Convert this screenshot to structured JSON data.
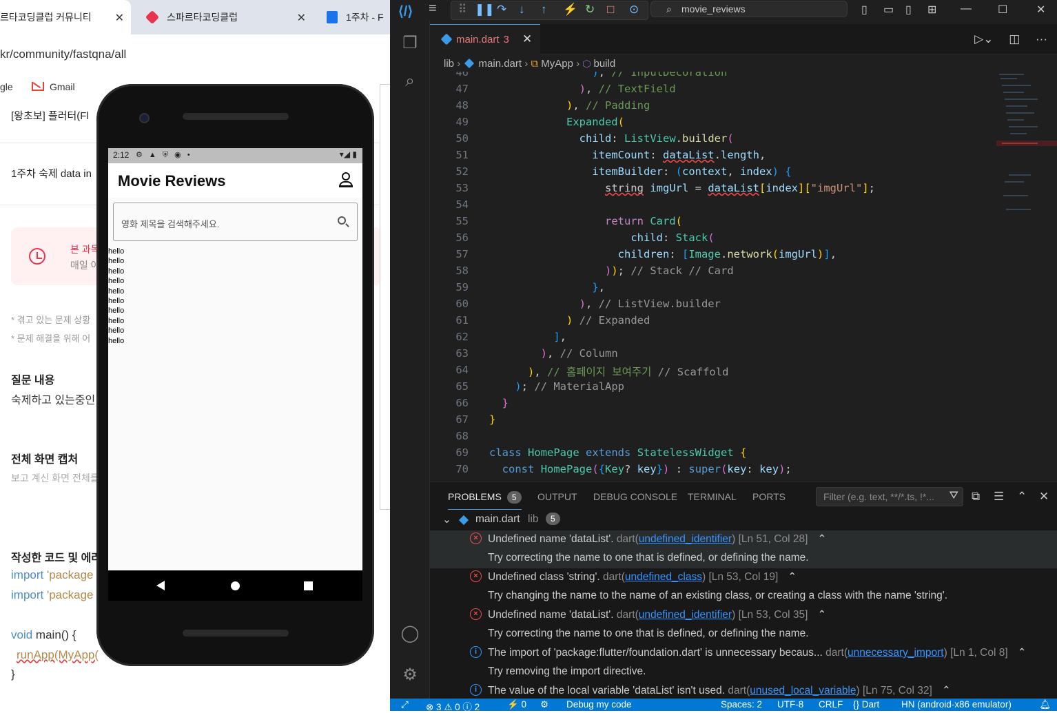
{
  "browser": {
    "tabs": [
      {
        "label": "르타코딩클럽 커뮤니티"
      },
      {
        "label": "스파르타코딩클럽"
      },
      {
        "label": "1주차 - F"
      }
    ],
    "address": "kr/community/fastqna/all",
    "bookmarks": [
      {
        "label": "gle"
      },
      {
        "label": "Gmail"
      }
    ],
    "post_title": "[왕초보] 플러터(Fl",
    "post_item": "1주차 숙제 data in",
    "notice_line1": "본 과목은",
    "notice_line2": "매일 아침",
    "hint1": "* 겪고 있는 문제 상황",
    "hint2": "* 문제 해결을 위해 어",
    "section_question": "질문 내용",
    "section_question_body": "숙제하고 있는중인",
    "section_capture": "전체 화면 캡처",
    "section_capture_sub": "보고 계신 화면 전체를",
    "section_code": "작성한 코드 및 에러",
    "code_lines": [
      {
        "kw": "import",
        "str": "'package"
      },
      {
        "kw": "import",
        "str": "'package"
      }
    ],
    "code_void": "void",
    "code_main": "main() {",
    "code_runapp": "runApp(MyApp(",
    "code_close": "}"
  },
  "emulator": {
    "status_time": "2:12",
    "status_icons": "⚙ ▲ ⛨ ◉ •",
    "status_right": "▾◢ ▮",
    "app_title": "Movie Reviews",
    "search_placeholder": "영화 제목을 검색해주세요.",
    "list_items": [
      "hello",
      "hello",
      "hello",
      "hello",
      "hello",
      "hello",
      "hello",
      "hello",
      "hello",
      "hello"
    ],
    "toolbar": {
      "minimize": "–",
      "close": "×",
      "more": "•••"
    }
  },
  "vscode": {
    "search_title": "movie_reviews",
    "tab": {
      "filename": "main.dart",
      "problem_count": "3"
    },
    "breadcrumb": [
      "lib",
      "main.dart",
      "MyApp",
      "build"
    ],
    "panel_tabs": [
      "PROBLEMS",
      "OUTPUT",
      "DEBUG CONSOLE",
      "TERMINAL",
      "PORTS"
    ],
    "problems_count": "5",
    "filter_placeholder": "Filter (e.g. text, **/*.ts, !*...",
    "problems_file": "main.dart",
    "problems_folder": "lib",
    "problems": [
      {
        "severity": "error",
        "message": "Undefined name 'dataList'.",
        "source": "dart(",
        "code": "undefined_identifier",
        "close": ")",
        "pos": "[Ln 51, Col 28]",
        "hint": "Try correcting the name to one that is defined, or defining the name."
      },
      {
        "severity": "error",
        "message": "Undefined class 'string'.",
        "source": "dart(",
        "code": "undefined_class",
        "close": ")",
        "pos": "[Ln 53, Col 19]",
        "hint": "Try changing the name to the name of an existing class, or creating a class with the name 'string'."
      },
      {
        "severity": "error",
        "message": "Undefined name 'dataList'.",
        "source": "dart(",
        "code": "undefined_identifier",
        "close": ")",
        "pos": "[Ln 53, Col 35]",
        "hint": "Try correcting the name to one that is defined, or defining the name."
      },
      {
        "severity": "info",
        "message": "The import of 'package:flutter/foundation.dart' is unnecessary becaus...",
        "source": "dart(",
        "code": "unnecessary_import",
        "close": ")",
        "pos": "[Ln 1, Col 8]",
        "hint": "Try removing the import directive."
      },
      {
        "severity": "info",
        "message": "The value of the local variable 'dataList' isn't used.",
        "source": "dart(",
        "code": "unused_local_variable",
        "close": ")",
        "pos": "[Ln 75, Col 32]",
        "hint": ""
      }
    ],
    "status": {
      "errors": "⊗ 3 ⚠ 0 ⓘ 2",
      "ports": "⚡ 0",
      "debug": "Debug my code",
      "spaces": "Spaces: 2",
      "encoding": "UTF-8",
      "eol": "CRLF",
      "lang": "{} Dart",
      "device": "HN (android-x86 emulator)"
    }
  }
}
